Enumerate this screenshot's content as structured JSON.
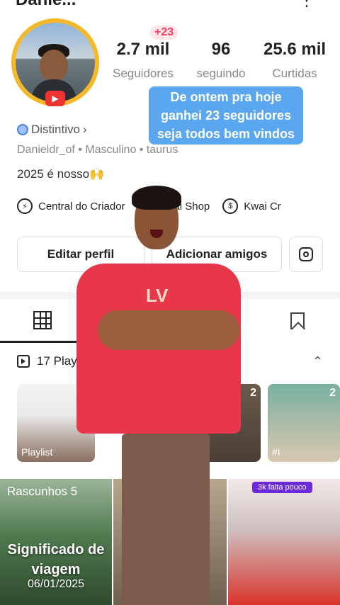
{
  "header": {
    "name": "Danie..."
  },
  "stats": {
    "followers_delta": "+23",
    "followers": {
      "value": "2.7 mil",
      "label": "Seguidores"
    },
    "following": {
      "value": "96",
      "label": "seguindo"
    },
    "likes": {
      "value": "25.6 mil",
      "label": "Curtidas"
    }
  },
  "caption": {
    "text": "De ontem pra hoje ganhei 23 seguidores seja todos bem vindos"
  },
  "profile": {
    "distintivo": "Distintivo",
    "info": "Danieldr_of  •  Masculino  •  taurus",
    "bio": "2025 é nosso🙌"
  },
  "quick_links": [
    {
      "label": "Central do Criador",
      "icon": "bolt-icon"
    },
    {
      "label": "Kwai Shop",
      "icon": "shop-icon"
    },
    {
      "label": "Kwai Cr",
      "icon": "moneybag-icon"
    }
  ],
  "actions": {
    "edit": "Editar perfil",
    "add_friends": "Adicionar amigos",
    "instagram_icon": "instagram-icon"
  },
  "playlists": {
    "title": "17 Playlists"
  },
  "thumbnails": [
    {
      "count": "2",
      "label": "Playlist"
    },
    {
      "count": "2",
      "label": ""
    },
    {
      "count": "2",
      "label": "#I"
    }
  ],
  "grid": {
    "rascunhos": "Rascunhos 5",
    "sig_title": "Significado de viagem",
    "sig_date": "06/01/2025",
    "falta": "3k falta pouco"
  },
  "colors": {
    "accent": "#ff3b5c",
    "caption_bg": "#5aa7f0"
  }
}
